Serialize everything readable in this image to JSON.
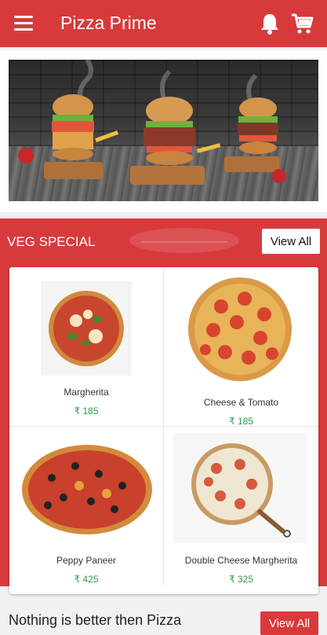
{
  "app": {
    "title": "Pizza Prime"
  },
  "colors": {
    "primary": "#d83a3c",
    "price": "#2e9b4a"
  },
  "icons": {
    "menu": "hamburger-icon",
    "notifications": "bell-icon",
    "cart": "cart-icon"
  },
  "veg_section": {
    "title": "VEG SPECIAL",
    "view_all": "View All",
    "items": [
      {
        "name": "Margherita",
        "price": "₹ 185"
      },
      {
        "name": "Cheese & Tomato",
        "price": "₹ 185"
      },
      {
        "name": "Peppy Paneer",
        "price": "₹ 425"
      },
      {
        "name": "Double Cheese Margherita",
        "price": "₹ 325"
      }
    ]
  },
  "next_section": {
    "title": "Nothing is better then Pizza",
    "view_all": "View All"
  }
}
